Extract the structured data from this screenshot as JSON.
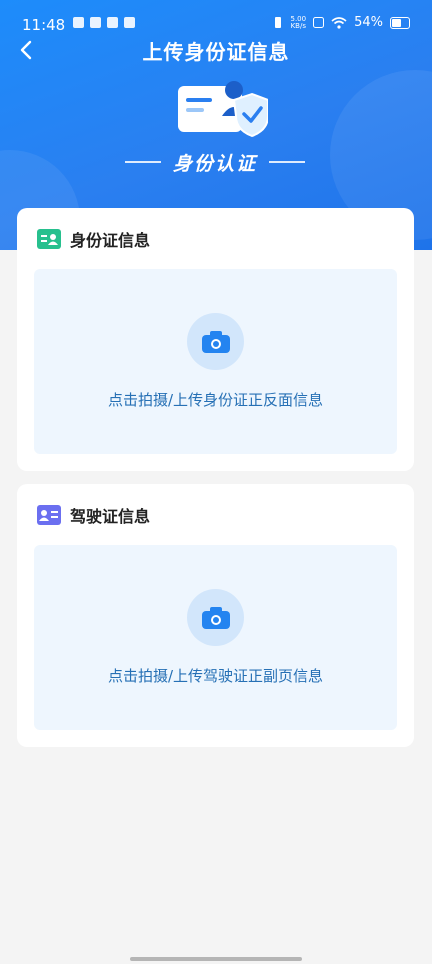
{
  "status_bar": {
    "time": "11:48",
    "net_speed_top": "5.00",
    "net_speed_unit": "KB/s",
    "battery": "54%"
  },
  "header": {
    "title": "上传身份证信息",
    "banner": "身份认证"
  },
  "cards": [
    {
      "label": "身份证信息",
      "upload_text": "点击拍摄/上传身份证正反面信息"
    },
    {
      "label": "驾驶证信息",
      "upload_text": "点击拍摄/上传驾驶证正副页信息"
    }
  ],
  "colors": {
    "header_blue": "#1d8cfb",
    "accent_green": "#27c08e",
    "accent_purple": "#6b6ff0",
    "upload_text": "#2670b5"
  }
}
